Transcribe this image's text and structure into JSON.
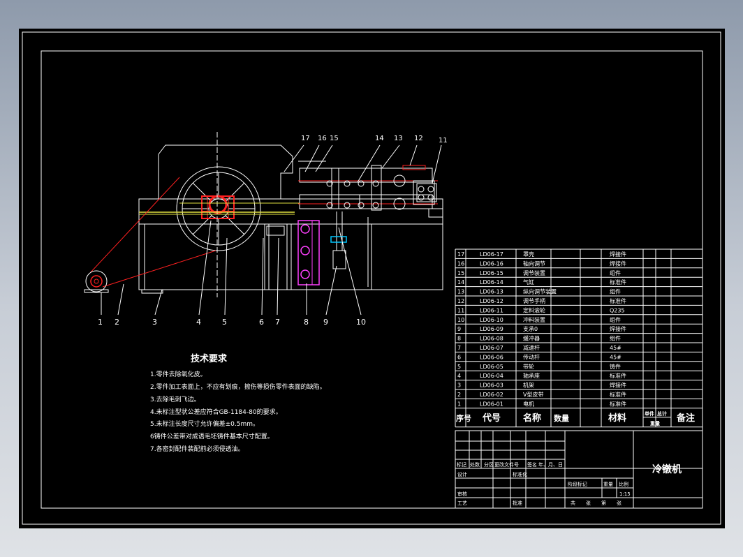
{
  "colors": {
    "background_gradient_top": "#8e9aab",
    "sheet": "#000000",
    "line": "#ffffff",
    "red": "#ff2020",
    "magenta": "#ff40ff",
    "cyan": "#00c8ff",
    "yellow": "#e0e040"
  },
  "callouts": [
    "1",
    "2",
    "3",
    "4",
    "5",
    "6",
    "7",
    "8",
    "9",
    "10",
    "11",
    "12",
    "13",
    "14",
    "15",
    "16",
    "17"
  ],
  "tech": {
    "title": "技术要求",
    "notes": [
      "1.零件去除氧化皮。",
      "2.零件加工表面上，不应有划痕，擦伤等损伤零件表面的缺陷。",
      "3.去除毛刺飞边。",
      "4.未标注型状公差应符合GB-1184-80的要求。",
      "5.未标注长度尺寸允许偏差±0.5mm。",
      "6铸件公差带对成语毛坯铸件基本尺寸配置。",
      "7.各密封配件装配前必须侵透油。"
    ]
  },
  "bom": {
    "rows": [
      {
        "no": "17",
        "code": "LD06-17",
        "name": "罩壳",
        "material": "焊接件"
      },
      {
        "no": "16",
        "code": "LD06-16",
        "name": "轴向调节",
        "material": "焊接件"
      },
      {
        "no": "15",
        "code": "LD06-15",
        "name": "调节装置",
        "material": "组件"
      },
      {
        "no": "14",
        "code": "LD06-14",
        "name": "气缸",
        "material": "标准件"
      },
      {
        "no": "13",
        "code": "LD06-13",
        "name": "纵向调节装置",
        "material": "组件"
      },
      {
        "no": "12",
        "code": "LD06-12",
        "name": "调节手柄",
        "material": "标准件"
      },
      {
        "no": "11",
        "code": "LD06-11",
        "name": "定料滚轮",
        "material": "Q235"
      },
      {
        "no": "10",
        "code": "LD06-10",
        "name": "冲料装置",
        "material": "组件"
      },
      {
        "no": "9",
        "code": "LD06-09",
        "name": "支承0",
        "material": "焊接件"
      },
      {
        "no": "8",
        "code": "LD06-08",
        "name": "缓冲器",
        "material": "组件"
      },
      {
        "no": "7",
        "code": "LD06-07",
        "name": "减速杆",
        "material": "45#"
      },
      {
        "no": "6",
        "code": "LD06-06",
        "name": "传动杆",
        "material": "45#"
      },
      {
        "no": "5",
        "code": "LD06-05",
        "name": "带轮",
        "material": "铸件"
      },
      {
        "no": "4",
        "code": "LD06-04",
        "name": "轴承座",
        "material": "标准件"
      },
      {
        "no": "3",
        "code": "LD06-03",
        "name": "机架",
        "material": "焊接件"
      },
      {
        "no": "2",
        "code": "LD06-02",
        "name": "V型皮带",
        "material": "标准件"
      },
      {
        "no": "1",
        "code": "LD06-01",
        "name": "电机",
        "material": "标准件"
      }
    ],
    "header": {
      "no": "序号",
      "code": "代号",
      "name": "名称",
      "qty": "数量",
      "material": "材料",
      "unit": "单件",
      "total": "总计",
      "weight": "重量",
      "remark": "备注"
    }
  },
  "titleblock": {
    "row_labels": [
      "标记",
      "处数",
      "分区",
      "更改文件号",
      "签名",
      "年、月、日"
    ],
    "design": "设计",
    "std": "标准化",
    "stage_labels": [
      "阶段标记",
      "重量",
      "比例"
    ],
    "scale": "1:15",
    "review": "审核",
    "process": "工艺",
    "approve": "批准",
    "sheets": [
      "共",
      "张",
      "第",
      "张"
    ],
    "drawing_name": "冷镦机"
  }
}
